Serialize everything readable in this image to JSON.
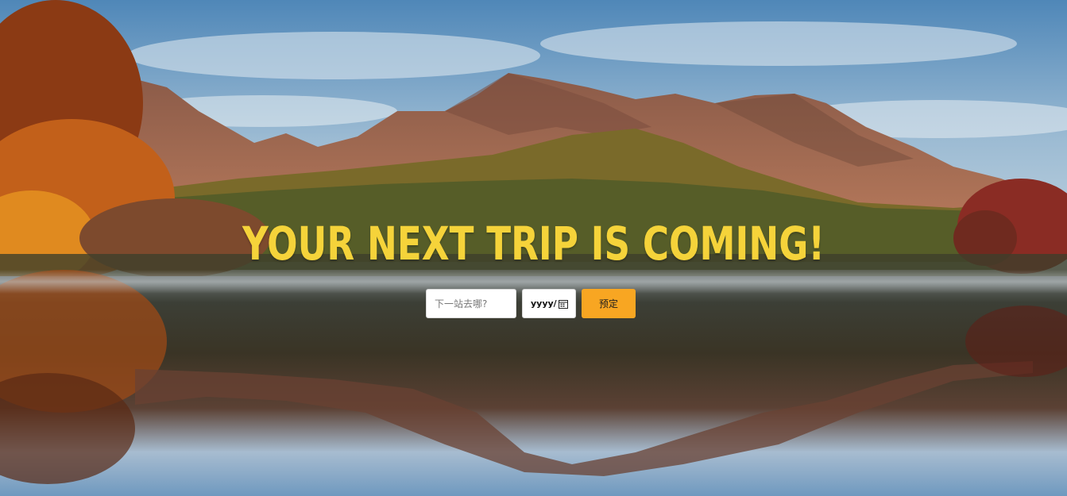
{
  "hero": {
    "headline": "Your next trip is coming!",
    "headline_color": "#f5d33a"
  },
  "booking": {
    "destination_placeholder": "下一站去哪?",
    "destination_value": "",
    "date_placeholder": "yyyy/",
    "date_icon": "calendar-icon",
    "book_label": "预定",
    "book_color": "#f8a622"
  }
}
